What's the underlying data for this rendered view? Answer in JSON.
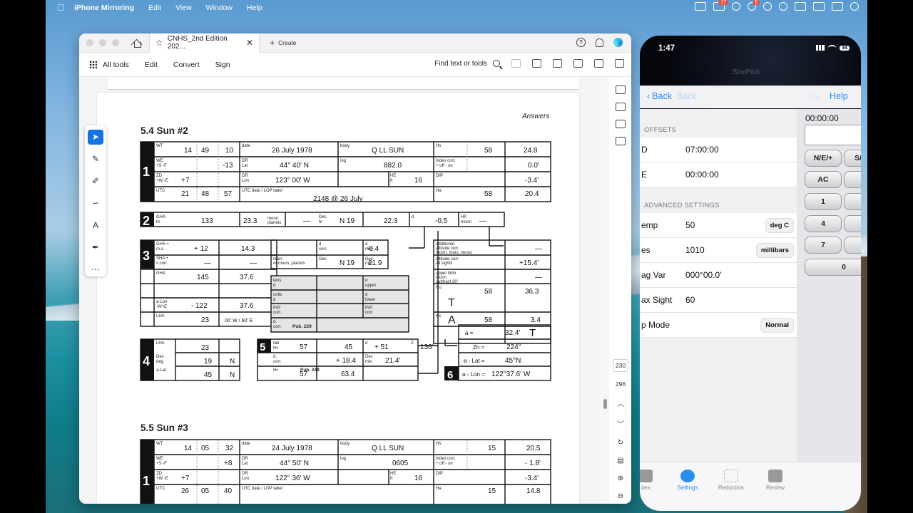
{
  "menubar": {
    "app_name": "iPhone Mirroring",
    "items": [
      "Edit",
      "View",
      "Window",
      "Help"
    ],
    "notification_badge": "17",
    "badge2": "6"
  },
  "pdf": {
    "tab_title": "CNHS_2nd Edition 202...",
    "create_label": "Create",
    "help_icon_label": "?",
    "toolbar": {
      "all_tools": "All tools",
      "edit": "Edit",
      "convert": "Convert",
      "sign": "Sign",
      "find": "Find text or tools"
    },
    "page_numbers": {
      "current": "230",
      "total": "296"
    },
    "answers_label": "Answers",
    "section1_title": "5.4 Sun #2",
    "section2_title": "5.5 Sun #3",
    "form1": {
      "row1": {
        "wt_h": "14",
        "wt_m": "49",
        "wt_s": "10",
        "date": "26 July 1978",
        "body": "Q LL SUN",
        "hs_deg": "58",
        "hs_min": "24.8"
      },
      "row2": {
        "we": "-13",
        "dr_lat": "44° 40' N",
        "log": "882.0",
        "index_corr": "0.0'"
      },
      "row3": {
        "zd": "+7",
        "dr_lon": "123° 00' W",
        "he": "16",
        "dip": "-3.4'"
      },
      "row4": {
        "utc_h": "21",
        "utc_m": "48",
        "utc_s": "57",
        "utc_label": "2148 @ 26 July",
        "ha_deg": "58",
        "ha_min": "20.4"
      },
      "row5": {
        "gha_hr": "133",
        "gha_min": "23.3",
        "moon": "—",
        "dec_hr": "N 19",
        "dec_min": "22.3",
        "d": "-0.5",
        "hp": "—"
      },
      "row6": {
        "gha_ms": "+ 12",
        "gha_ms_min": "14.3",
        "d_corr": "-0.4",
        "add_alt": "—"
      },
      "row7": {
        "sha": "—",
        "sha_min": "—",
        "dec": "N 19",
        "dec_min": "21.9",
        "alt_corr": "+15.4'"
      },
      "row8": {
        "gha_deg": "145",
        "gha_min": "37.6",
        "upper_limb": "—"
      },
      "row9": {
        "alon_deg": "- 122",
        "alon_min": "37.6",
        "ho_deg": "58",
        "ho_min": "36.3"
      },
      "row10": {
        "lha_deg": "23",
        "lha_note": "00' W / 60' E",
        "hc_deg": "58",
        "hc_min": "3.4"
      },
      "box4": {
        "lha": "23",
        "dec_deg": "19",
        "dec_ns": "N",
        "alat": "45",
        "alat_ns": "N"
      },
      "box5": {
        "tab_deg": "57",
        "tab_min": "45",
        "d": "+ 51",
        "z": "136°",
        "corr": "+ 18.4",
        "dec_min": "21.4'",
        "hc_deg": "57",
        "hc_min": "63.4"
      },
      "box6": {
        "a": "32.4'",
        "a_dir": "T",
        "zn": "224°",
        "a_lat": "45°N",
        "a_lon": "122°37.6' W"
      }
    },
    "form2": {
      "wt_h": "14",
      "wt_m": "05",
      "wt_s": "32",
      "date": "24 July 1978",
      "body": "Q LL SUN",
      "hs_deg": "15",
      "hs_min": "20.5",
      "we": "+8",
      "dr_lat": "44° 50' N",
      "log": "0605",
      "index_corr": "- 1.8'",
      "zd": "+7",
      "dr_lon": "122° 36' W",
      "he": "16",
      "dip": "-3.4'",
      "utc_h": "26",
      "utc_m": "05",
      "utc_s": "40",
      "ha_deg": "15",
      "ha_min": "14.8"
    }
  },
  "phone": {
    "time": "1:47",
    "battery": "34",
    "app_title": "StarPilot",
    "nav": {
      "back": "Back",
      "back_ghost": "Back",
      "hidden": "Help",
      "help": "Help"
    },
    "sections": {
      "offsets": "OFFSETS",
      "advanced": "ADVANCED SETTINGS"
    },
    "rows": [
      {
        "label": "D",
        "value": "07:00:00"
      },
      {
        "label": "E",
        "value": "00:00:00"
      },
      {
        "label": "emp",
        "value": "50",
        "pill": "deg C"
      },
      {
        "label": "es",
        "value": "1010",
        "pill": "millibars"
      },
      {
        "label": "ag Var",
        "value": "000°00.0'"
      },
      {
        "label": "ax Sight",
        "value": "60"
      },
      {
        "label": "p Mode",
        "value": "",
        "pill": "Normal"
      }
    ],
    "calc": {
      "display": "00:00:00",
      "keys": [
        "N/E/+",
        "S/",
        "AC",
        "",
        "1",
        "",
        "4",
        "",
        "7",
        "",
        "0"
      ]
    },
    "tabs": [
      "dex",
      "Settings",
      "Reduction",
      "Review"
    ],
    "accent": "#2a8df0"
  }
}
